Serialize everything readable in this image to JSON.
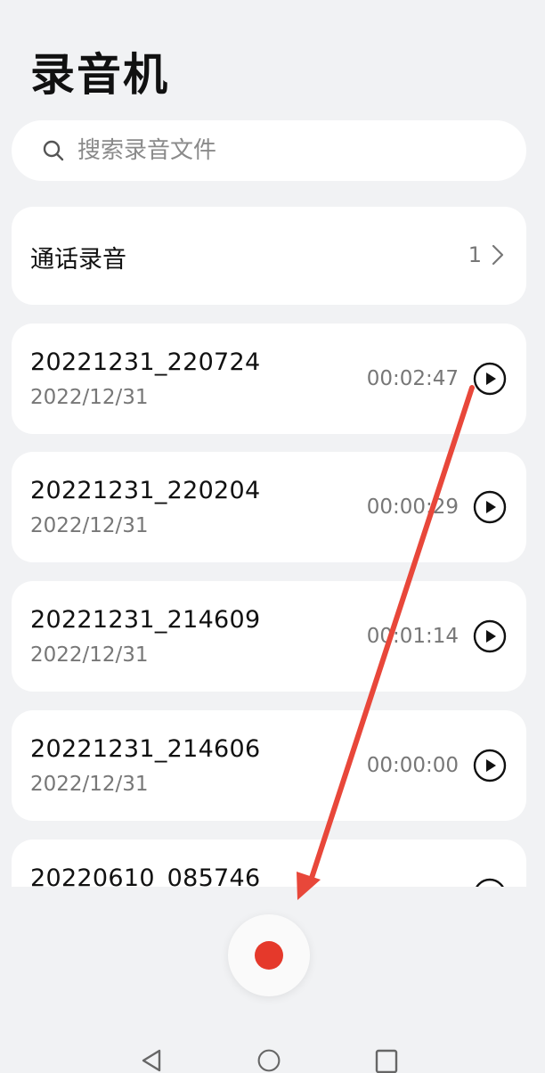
{
  "app": {
    "title": "录音机"
  },
  "search": {
    "placeholder": "搜索录音文件",
    "icon": "search-icon"
  },
  "call_recordings": {
    "label": "通话录音",
    "count": "1",
    "icon": "chevron-right-icon"
  },
  "recordings": [
    {
      "name": "20221231_220724",
      "date": "2022/12/31",
      "duration": "00:02:47"
    },
    {
      "name": "20221231_220204",
      "date": "2022/12/31",
      "duration": "00:00:29"
    },
    {
      "name": "20221231_214609",
      "date": "2022/12/31",
      "duration": "00:01:14"
    },
    {
      "name": "20221231_214606",
      "date": "2022/12/31",
      "duration": "00:00:00"
    },
    {
      "name": "20220610_085746",
      "date": "",
      "duration": ""
    }
  ],
  "colors": {
    "background": "#f1f2f4",
    "record_accent": "#e5392b",
    "annotation_arrow": "#e8473a"
  },
  "icons": [
    "search-icon",
    "chevron-right-icon",
    "play-icon",
    "record-icon",
    "back-icon",
    "home-icon",
    "recents-icon"
  ]
}
